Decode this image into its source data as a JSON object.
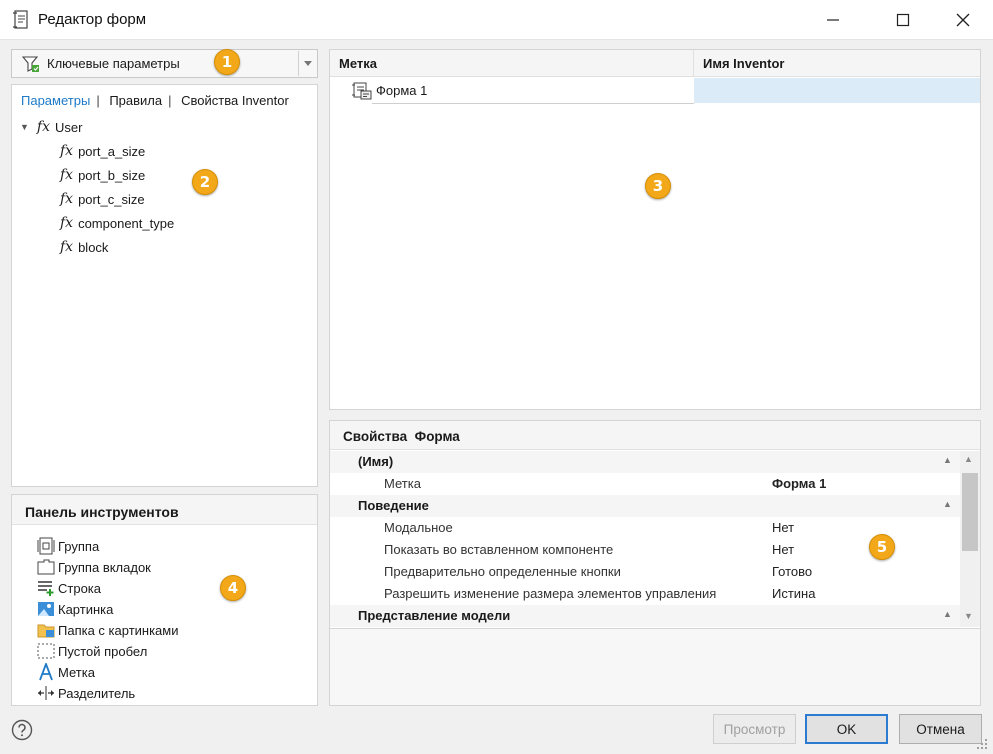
{
  "window": {
    "title": "Редактор форм",
    "icons": {
      "app": "form-editor-icon",
      "minimize": "minimize-icon",
      "maximize": "maximize-icon",
      "close": "close-icon"
    }
  },
  "filter": {
    "value": "Ключевые параметры",
    "icon": "filter-icon"
  },
  "params": {
    "tabs": [
      "Параметры",
      "Правила",
      "Свойства Inventor"
    ],
    "separator": "|",
    "tree": {
      "root": {
        "fx": "fx",
        "label": "User"
      },
      "children": [
        {
          "fx": "fx",
          "label": "port_a_size"
        },
        {
          "fx": "fx",
          "label": "port_b_size"
        },
        {
          "fx": "fx",
          "label": "port_c_size"
        },
        {
          "fx": "fx",
          "label": "component_type"
        },
        {
          "fx": "fx",
          "label": "block"
        }
      ]
    }
  },
  "toolbox": {
    "title": "Панель инструментов",
    "items": [
      {
        "label": "Группа",
        "icon": "group-icon"
      },
      {
        "label": "Группа вкладок",
        "icon": "tab-group-icon"
      },
      {
        "label": "Строка",
        "icon": "row-icon"
      },
      {
        "label": "Картинка",
        "icon": "picture-icon"
      },
      {
        "label": "Папка с картинками",
        "icon": "picture-folder-icon"
      },
      {
        "label": "Пустой пробел",
        "icon": "empty-space-icon"
      },
      {
        "label": "Метка",
        "icon": "label-icon"
      },
      {
        "label": "Разделитель",
        "icon": "splitter-icon"
      }
    ]
  },
  "grid": {
    "columns": [
      "Метка",
      "Имя Inventor"
    ],
    "rows": [
      {
        "label": "Форма 1",
        "inventor_name": "",
        "icon": "form-icon"
      }
    ]
  },
  "properties": {
    "title": "Свойства  Форма",
    "categories": [
      {
        "label": "(Имя)",
        "rows": [
          {
            "name": "Метка",
            "value": "Форма 1"
          }
        ]
      },
      {
        "label": "Поведение",
        "rows": [
          {
            "name": "Модальное",
            "value": "Нет"
          },
          {
            "name": "Показать во вставленном компоненте",
            "value": "Нет"
          },
          {
            "name": "Предварительно определенные кнопки",
            "value": "Готово"
          },
          {
            "name": "Разрешить изменение размера элементов управления",
            "value": "Истина"
          }
        ]
      },
      {
        "label": "Представление модели",
        "rows": []
      }
    ]
  },
  "badges": [
    "1",
    "2",
    "3",
    "4",
    "5"
  ],
  "buttons": {
    "preview": "Просмотр",
    "ok": "OK",
    "cancel": "Отмена",
    "help_icon": "help-icon"
  },
  "colors": {
    "accent": "#1e7ac8",
    "badge": "#f2a818",
    "selected_cell": "#dbecf8"
  }
}
